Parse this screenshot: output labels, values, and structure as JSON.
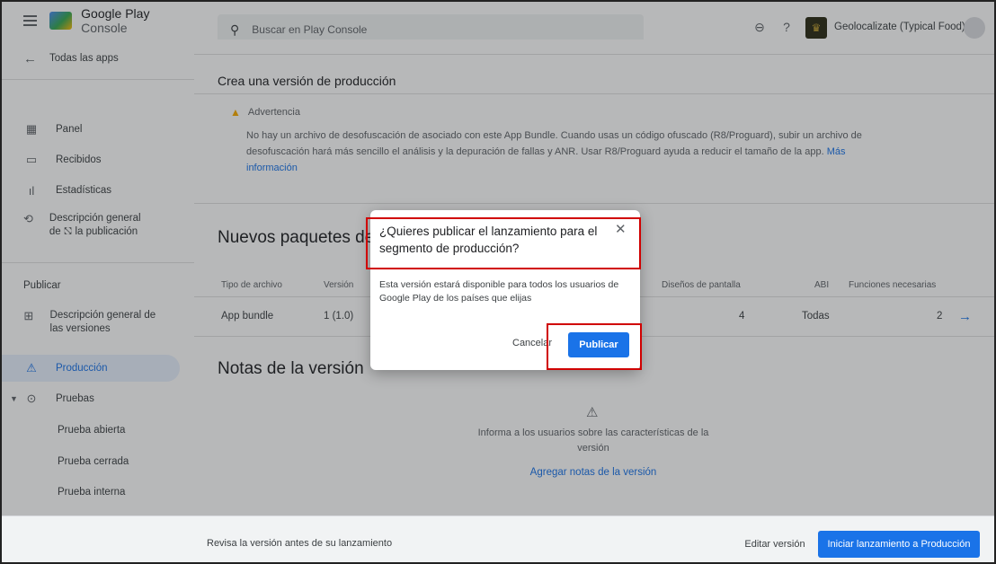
{
  "brand": {
    "name_prefix": "Google Play",
    "name_suffix": " Console"
  },
  "topbar": {
    "search_placeholder": "Buscar en Play Console",
    "app_name": "Geolocalizate (Typical Food)",
    "link_icon": "link-icon",
    "help_icon": "help-icon"
  },
  "sidebar": {
    "back_label": "Todas las apps",
    "items": [
      {
        "label": "Panel",
        "icon": "dashboard-icon"
      },
      {
        "label": "Recibidos",
        "icon": "inbox-icon"
      },
      {
        "label": "Estadísticas",
        "icon": "stats-icon"
      },
      {
        "label": "Descripción general de ⛞ la publicación",
        "icon": "publishing-overview-icon"
      }
    ],
    "section_label": "Publicar",
    "publish_items": [
      {
        "label": "Descripción general de las versiones",
        "icon": "releases-overview-icon"
      },
      {
        "label": "Producción",
        "icon": "production-icon"
      },
      {
        "label": "Pruebas",
        "icon": "testing-icon"
      }
    ],
    "sub_items": [
      "Prueba abierta",
      "Prueba cerrada",
      "Prueba interna"
    ]
  },
  "main": {
    "page_title": "Crea una versión de producción",
    "warning": {
      "title": "Advertencia",
      "body": "No hay un archivo de desofuscación de asociado con este App Bundle. Cuando usas un código ofuscado (R8/Proguard), subir un archivo de desofuscación hará más sencillo el análisis y la depuración de fallas y ANR. Usar R8/Proguard ayuda a reducir el tamaño de la app. ",
      "link": "Más información"
    },
    "packages_title": "Nuevos paquetes de",
    "table": {
      "headers": [
        "Tipo de archivo",
        "Versión",
        "Diseños de pantalla",
        "ABI",
        "Funciones necesarias"
      ],
      "row": [
        "App bundle",
        "1 (1.0)",
        "4",
        "Todas",
        "2"
      ]
    },
    "notes_title": "Notas de la versión",
    "notes_text": "Informa a los usuarios sobre las características de la versión",
    "notes_link": "Agregar notas de la versión"
  },
  "bottombar": {
    "review_text": "Revisa la versión antes de su lanzamiento",
    "edit_label": "Editar versión",
    "launch_label": "Iniciar lanzamiento a Producción"
  },
  "dialog": {
    "title": "¿Quieres publicar el lanzamiento para el segmento de producción?",
    "body": "Esta versión estará disponible para todos los usuarios de Google Play de los países que elijas",
    "cancel_label": "Cancelar",
    "publish_label": "Publicar"
  },
  "colors": {
    "accent": "#1a73e8",
    "highlight": "#d00000",
    "warning": "#f9ab00"
  }
}
